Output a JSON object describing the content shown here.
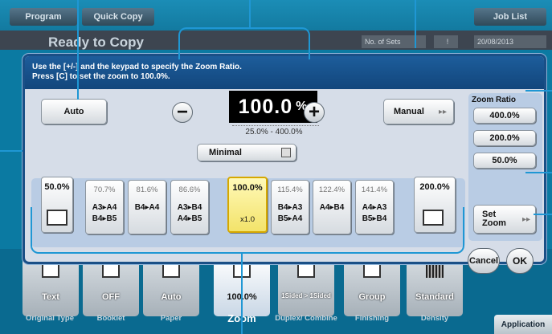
{
  "top_tabs": {
    "program": "Program",
    "quick_copy": "Quick Copy",
    "job_list": "Job List"
  },
  "status": {
    "ready": "Ready to Copy",
    "no_of_sets": "No. of Sets",
    "date": "20/08/2013"
  },
  "dialog": {
    "instruction_line1": "Use the [+/-] and the keypad to specify the Zoom Ratio.",
    "instruction_line2": "Press [C] to set the zoom to 100.0%.",
    "auto_label": "Auto",
    "manual_label": "Manual",
    "minus_label": "−",
    "plus_label": "+",
    "ratio_value": "100.0",
    "ratio_unit": "%",
    "range": "25.0% - 400.0%",
    "minimal_label": "Minimal",
    "presets": [
      {
        "pct": "50.0%"
      },
      {
        "pct": "70.7%",
        "line1": "A3▸A4",
        "line2": "B4▸B5"
      },
      {
        "pct": "81.6%",
        "line1": "B4▸A4",
        "line2": ""
      },
      {
        "pct": "86.6%",
        "line1": "A3▸B4",
        "line2": "A4▸B5"
      },
      {
        "pct": "100.0%",
        "line1": "",
        "line2": "x1.0"
      },
      {
        "pct": "115.4%",
        "line1": "B4▸A3",
        "line2": "B5▸A4"
      },
      {
        "pct": "122.4%",
        "line1": "A4▸B4",
        "line2": ""
      },
      {
        "pct": "141.4%",
        "line1": "A4▸A3",
        "line2": "B5▸B4"
      },
      {
        "pct": "200.0%"
      }
    ],
    "zoom_ratio_title": "Zoom Ratio",
    "zoom_ratio_options": [
      "400.0%",
      "200.0%",
      "50.0%"
    ],
    "set_zoom_line1": "Set",
    "set_zoom_line2": "Zoom",
    "cancel_label": "Cancel",
    "ok_label": "OK"
  },
  "functions": [
    {
      "value": "Text",
      "label": "Original Type"
    },
    {
      "value": "OFF",
      "label": "Booklet"
    },
    {
      "value": "Auto",
      "label": "Paper"
    },
    {
      "value": "100.0%",
      "label": "Zoom"
    },
    {
      "value": "1Sided > 1Sided",
      "label": "Duplex/ Combine"
    },
    {
      "value": "Group",
      "label": "Finishing"
    },
    {
      "value": "Standard",
      "label": "Density"
    }
  ],
  "application_label": "Application",
  "colors": {
    "accent": "#1f97d4",
    "selected": "#f3e36a",
    "dialog": "#d6dde8"
  }
}
